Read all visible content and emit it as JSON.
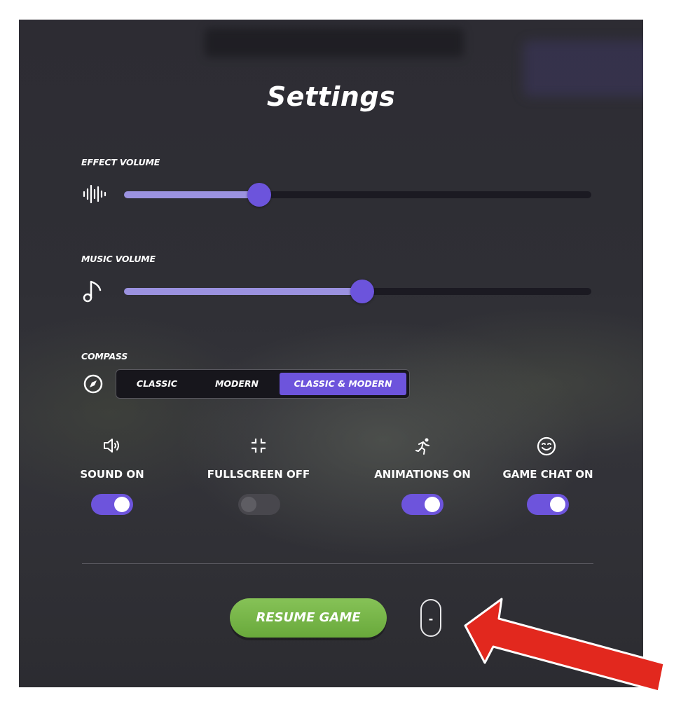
{
  "title": "Settings",
  "effect_volume": {
    "label": "EFFECT VOLUME",
    "value": 0.29
  },
  "music_volume": {
    "label": "MUSIC VOLUME",
    "value": 0.51
  },
  "compass": {
    "label": "COMPASS",
    "options": [
      "CLASSIC",
      "MODERN",
      "CLASSIC & MODERN"
    ],
    "selected": "CLASSIC & MODERN"
  },
  "toggles": [
    {
      "label": "SOUND ON",
      "icon": "speaker-icon",
      "state": true
    },
    {
      "label": "FULLSCREEN OFF",
      "icon": "exit-fullscreen-icon",
      "state": false
    },
    {
      "label": "ANIMATIONS ON",
      "icon": "running-person-icon",
      "state": true
    },
    {
      "label": "GAME CHAT ON",
      "icon": "smiley-icon",
      "state": true
    }
  ],
  "resume_button": "RESUME GAME",
  "minus_button": "-",
  "colors": {
    "accent": "#6d54dc",
    "slider_fill": "#9b92e0",
    "resume": "#77b548",
    "annotation_arrow": "#e2281e"
  }
}
